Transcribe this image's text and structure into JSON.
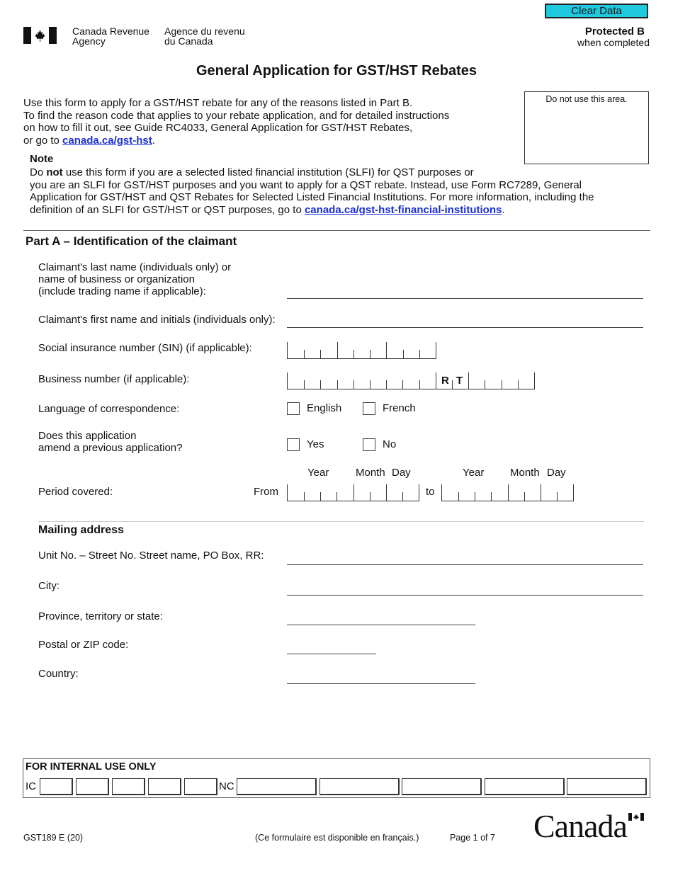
{
  "header": {
    "clear_button": "Clear Data",
    "agency_en_line1": "Canada Revenue",
    "agency_en_line2": "Agency",
    "agency_fr_line1": "Agence du revenu",
    "agency_fr_line2": "du Canada",
    "protected": "Protected B",
    "protected_sub": "when completed"
  },
  "title": "General Application for GST/HST Rebates",
  "intro": {
    "line1": "Use this form to apply for a GST/HST rebate for any of the reasons listed in Part B.",
    "line2": "To find the reason code that applies to your rebate application, and for detailed instructions",
    "line3": "on how to fill it out, see Guide RC4033, General Application for GST/HST Rebates,",
    "line4_prefix": "or go to ",
    "link": "canada.ca/gst-hst",
    "line4_suffix": "."
  },
  "do_not_use": "Do not use this area.",
  "note": {
    "heading": "Note",
    "p1": "Do ",
    "p1_bold": "not",
    "p1_rest": " use this form if you are a selected listed financial institution (SLFI) for QST purposes or",
    "line2": "you are an SLFI for GST/HST purposes and you want to apply for a QST rebate. Instead, use Form RC7289, General",
    "line3": "Application for GST/HST and QST Rebates for Selected Listed Financial Institutions. For more information, including the",
    "line4_prefix": "definition of an SLFI for GST/HST or QST purposes, go to ",
    "link": "canada.ca/gst-hst-financial-institutions",
    "line4_suffix": "."
  },
  "part_a": {
    "heading": "Part A – Identification of the claimant",
    "last_name_l1": "Claimant's last name (individuals only) or",
    "last_name_l2": "name of business or organization",
    "last_name_l3": "(include trading name if applicable):",
    "first_name": "Claimant's first name and initials (individuals only):",
    "sin": "Social insurance number (SIN) (if applicable):",
    "bn": "Business number (if applicable):",
    "bn_r": "R",
    "bn_t": "T",
    "language": "Language of correspondence:",
    "lang_options": [
      "English",
      "French"
    ],
    "amend_l1": "Does this application",
    "amend_l2": "amend a previous application?",
    "amend_options": [
      "Yes",
      "No"
    ],
    "period": "Period covered:",
    "from": "From",
    "to": "to",
    "date_headers": [
      "Year",
      "Month",
      "Day"
    ]
  },
  "mailing": {
    "heading": "Mailing address",
    "street": "Unit No. – Street No. Street name, PO Box, RR:",
    "city": "City:",
    "province": "Province, territory or state:",
    "postal": "Postal or ZIP code:",
    "country": "Country:"
  },
  "internal": {
    "heading": "FOR INTERNAL USE ONLY",
    "ic": "IC",
    "nc": "NC"
  },
  "footer": {
    "form_id": "GST189 E (20)",
    "french": "(Ce formulaire est disponible en français.)",
    "page": "Page 1 of 7",
    "wordmark": "Canada"
  },
  "colors": {
    "clear_button": "#1ec9e0",
    "link": "#1a2fd6"
  }
}
